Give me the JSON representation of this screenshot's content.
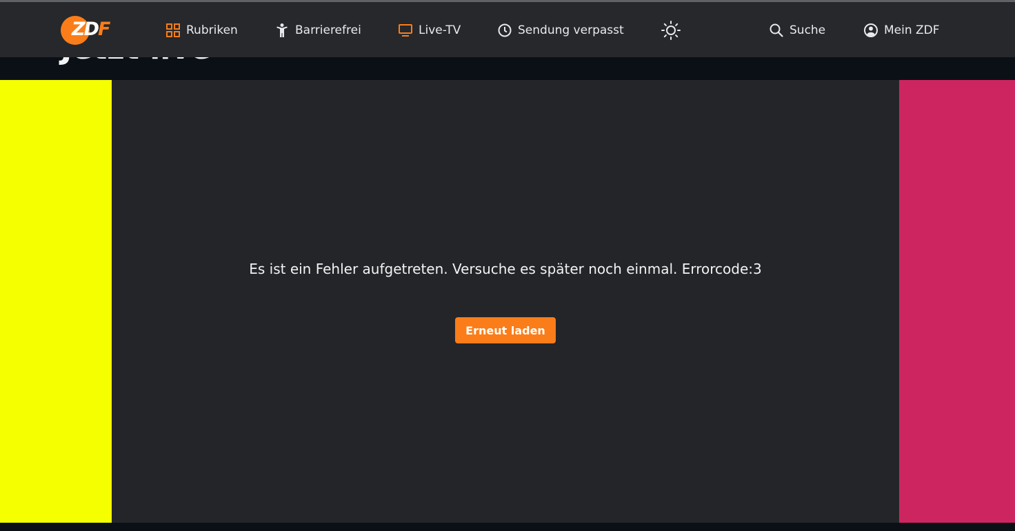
{
  "brand": {
    "logo_text": "ZDF",
    "accent_color": "#fa7d19"
  },
  "nav": {
    "rubriken": {
      "label": "Rubriken",
      "icon": "grid-icon"
    },
    "barrierefrei": {
      "label": "Barrierefrei",
      "icon": "accessibility-icon"
    },
    "live_tv": {
      "label": "Live-TV",
      "icon": "tv-icon"
    },
    "sendung_verpasst": {
      "label": "Sendung verpasst",
      "icon": "clock-icon"
    },
    "theme_toggle": {
      "icon": "sun-icon"
    },
    "suche": {
      "label": "Suche",
      "icon": "search-icon"
    },
    "mein_zdf": {
      "label": "Mein ZDF",
      "icon": "user-icon"
    }
  },
  "page": {
    "title": "Jetzt live"
  },
  "player": {
    "error_message": "Es ist ein Fehler aufgetreten. Versuche es später noch einmal. Errorcode:3",
    "retry_label": "Erneut laden",
    "side_left_color": "#f5ff00",
    "side_right_color": "#cd2560"
  }
}
